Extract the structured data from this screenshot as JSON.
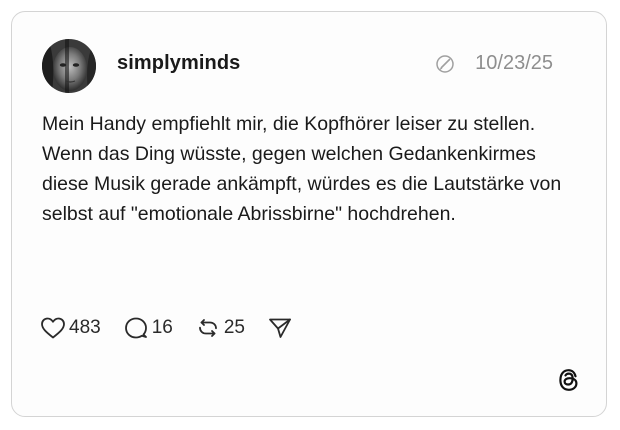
{
  "post": {
    "username": "simplyminds",
    "timestamp": "10/23/25",
    "text_lines": [
      "Mein Handy empfiehlt mir, die Kopfhörer leiser zu stellen.",
      "Wenn das Ding wüsste, gegen welchen Gedankenkirmes diese Musik gerade ankämpft, würdes es die Lautstärke von selbst auf \"emotionale Abrissbirne\" hochdrehen."
    ]
  },
  "actions": {
    "likes": "483",
    "replies": "16",
    "reposts": "25"
  },
  "icons": {
    "edited": "edited-icon",
    "like": "heart-icon",
    "reply": "comment-bubble-icon",
    "repost": "repost-icon",
    "share": "send-icon",
    "brand": "threads-logo-icon"
  }
}
